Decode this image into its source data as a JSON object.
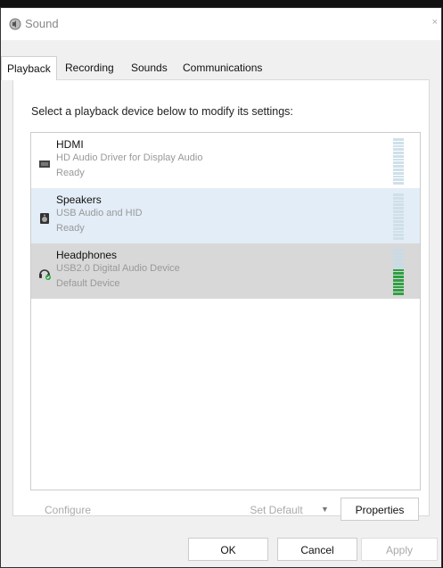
{
  "window": {
    "title": "Sound",
    "close_glyph": "×"
  },
  "tabs": [
    {
      "label": "Playback",
      "active": true
    },
    {
      "label": "Recording",
      "active": false
    },
    {
      "label": "Sounds",
      "active": false
    },
    {
      "label": "Communications",
      "active": false
    }
  ],
  "playback": {
    "instruction": "Select a playback device below to modify its settings:",
    "devices": [
      {
        "name": "HDMI",
        "description": "HD Audio Driver for Display Audio",
        "status": "Ready",
        "icon": "monitor-speaker-icon",
        "level": 0
      },
      {
        "name": "Speakers",
        "description": "USB Audio and HID",
        "status": "Ready",
        "icon": "speaker-icon",
        "level": 0
      },
      {
        "name": "Headphones",
        "description": "USB2.0 Digital Audio Device",
        "status": "Default Device",
        "icon": "headphones-default-icon",
        "level": 0.6
      }
    ],
    "buttons": {
      "configure": "Configure",
      "set_default": "Set Default",
      "set_default_arrow": "▼",
      "properties": "Properties"
    }
  },
  "footer": {
    "ok": "OK",
    "cancel": "Cancel",
    "apply": "Apply"
  },
  "colors": {
    "selected_row": "#e3edf7",
    "hover_row": "#d8d8d8",
    "meter_on": "#2ea043"
  }
}
